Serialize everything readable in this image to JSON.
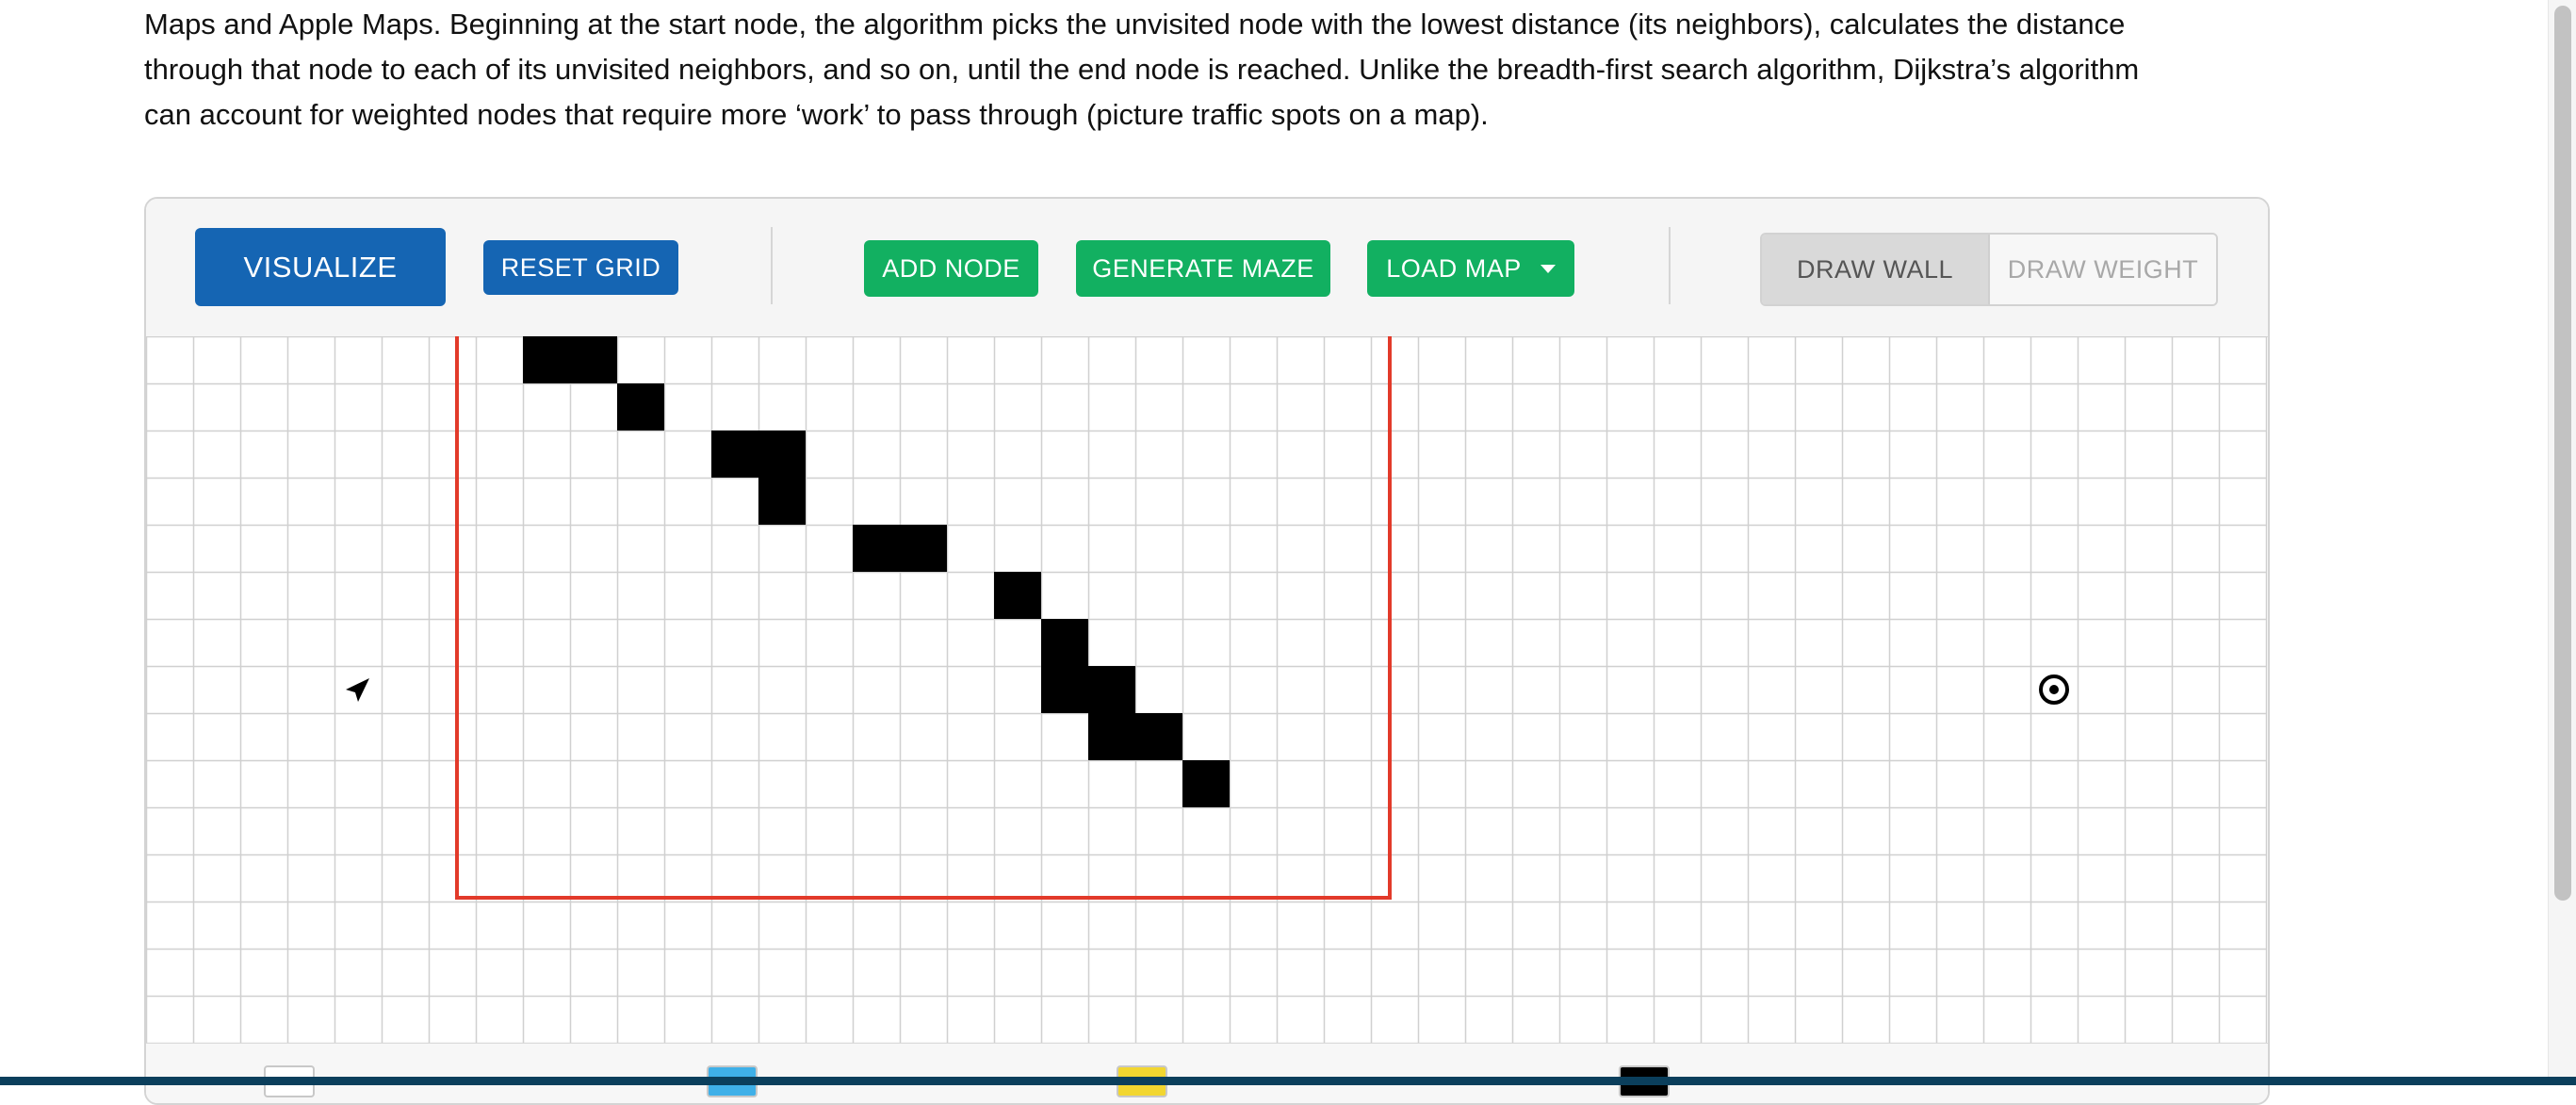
{
  "description": {
    "lines": [
      "Maps and Apple Maps. Beginning at the start node, the algorithm picks the unvisited node with the lowest distance (its neighbors), calculates the distance",
      "through that node to each of its unvisited neighbors, and so on, until the end node is reached. Unlike the breadth-first search algorithm, Dijkstra’s algorithm",
      "can account for weighted nodes that require more ‘work’ to pass through (picture traffic spots on a map)."
    ]
  },
  "toolbar": {
    "visualize_label": "VISUALIZE",
    "reset_label": "RESET GRID",
    "add_node_label": "ADD NODE",
    "generate_maze_label": "GENERATE MAZE",
    "load_map_label": "LOAD MAP",
    "draw_wall_label": "DRAW WALL",
    "draw_weight_label": "DRAW WEIGHT",
    "active_mode": "DRAW WALL"
  },
  "grid": {
    "columns": 45,
    "rows": 15,
    "walls": [
      [
        0,
        8
      ],
      [
        0,
        9
      ],
      [
        1,
        10
      ],
      [
        2,
        12
      ],
      [
        2,
        13
      ],
      [
        3,
        13
      ],
      [
        4,
        15
      ],
      [
        4,
        16
      ],
      [
        5,
        18
      ],
      [
        6,
        19
      ],
      [
        7,
        19
      ],
      [
        7,
        20
      ],
      [
        8,
        20
      ],
      [
        8,
        21
      ],
      [
        9,
        22
      ]
    ],
    "start_node": [
      7,
      4
    ],
    "end_node": [
      7,
      40
    ],
    "start_icon": "navigation-arrow-icon",
    "end_icon": "target-icon",
    "highlight_region": {
      "from": [
        0,
        7
      ],
      "to": [
        11,
        25
      ]
    }
  },
  "colors": {
    "primary_blue": "#1565b3",
    "green": "#12b061",
    "wall": "#000000",
    "grid_line": "#d0d0d0",
    "highlight_border": "#e23a2a"
  },
  "legend": {
    "swatches": [
      "#ffffff",
      "#3fb0e8",
      "#f2d630",
      "#000000"
    ]
  }
}
